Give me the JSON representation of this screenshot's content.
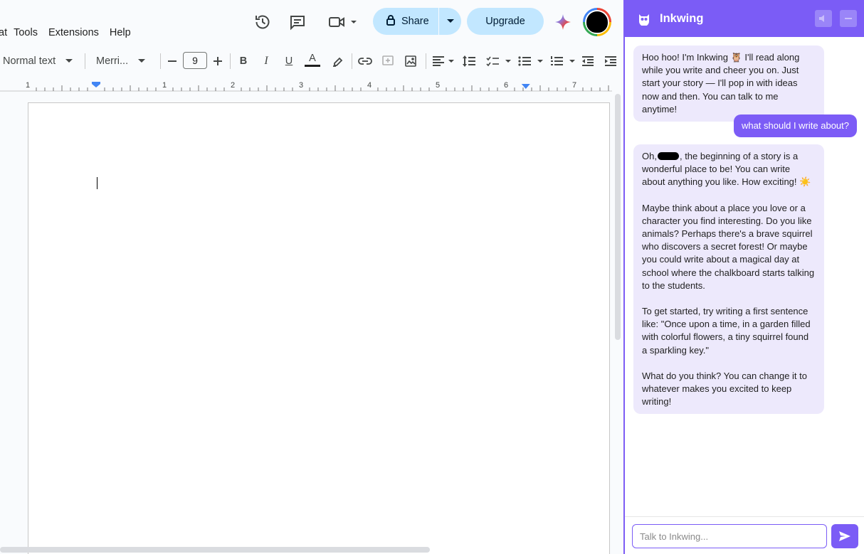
{
  "menubar": {
    "items": [
      "at",
      "Tools",
      "Extensions",
      "Help"
    ]
  },
  "header_icons": {
    "history": "history-icon",
    "comments": "comment-icon",
    "meet": "video-camera-icon",
    "gemini": "gemini-sparkle-icon"
  },
  "share": {
    "label": "Share",
    "icon": "lock-icon"
  },
  "upgrade": {
    "label": "Upgrade"
  },
  "toolbar": {
    "style_label": "Normal text",
    "font_label": "Merri...",
    "font_size": "9",
    "bold": "B",
    "italic": "I",
    "underline": "U",
    "text_color": "A"
  },
  "ruler": {
    "numbers": [
      "1",
      "1",
      "2",
      "3",
      "4",
      "5",
      "6",
      "7"
    ]
  },
  "inkwing": {
    "title": "Inkwing",
    "input_placeholder": "Talk to Inkwing...",
    "messages": [
      {
        "role": "bot",
        "text": "Hoo hoo! I'm Inkwing 🦉 I'll read along while you write and cheer you on. Just start your story — I'll pop in with ideas now and then. You can talk to me anytime!"
      },
      {
        "role": "user",
        "text": "what should I write about?"
      },
      {
        "role": "bot",
        "greeting_prefix": "Oh,",
        "greeting_suffix": ", the beginning of a story is a wonderful place to be! You can write about anything you like. How exciting! ☀️",
        "para2": "Maybe think about a place you love or a character you find interesting. Do you like animals? Perhaps there's a brave squirrel who discovers a secret forest! Or maybe you could write about a magical day at school where the chalkboard starts talking to the students.",
        "para3": "To get started, try writing a first sentence like: \"Once upon a time, in a garden filled with colorful flowers, a tiny squirrel found a sparkling key.\"",
        "para4": "What do you think? You can change it to whatever makes you excited to keep writing!"
      }
    ]
  },
  "colors": {
    "accent": "#7b5cf6",
    "bot_bubble": "#ede9fc",
    "share_bg": "#c2e7ff"
  }
}
